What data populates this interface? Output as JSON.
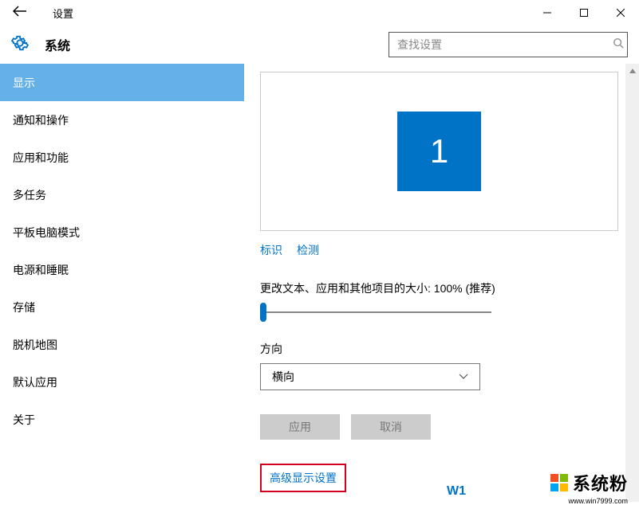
{
  "window": {
    "title": "设置",
    "controls": {
      "min": "—",
      "max": "☐",
      "close": "✕"
    }
  },
  "header": {
    "section": "系统",
    "search_placeholder": "查找设置"
  },
  "sidebar": {
    "items": [
      {
        "label": "显示",
        "selected": true
      },
      {
        "label": "通知和操作",
        "selected": false
      },
      {
        "label": "应用和功能",
        "selected": false
      },
      {
        "label": "多任务",
        "selected": false
      },
      {
        "label": "平板电脑模式",
        "selected": false
      },
      {
        "label": "电源和睡眠",
        "selected": false
      },
      {
        "label": "存储",
        "selected": false
      },
      {
        "label": "脱机地图",
        "selected": false
      },
      {
        "label": "默认应用",
        "selected": false
      },
      {
        "label": "关于",
        "selected": false
      }
    ]
  },
  "content": {
    "monitor_number": "1",
    "identify_label": "标识",
    "detect_label": "检测",
    "scale_label": "更改文本、应用和其他项目的大小: 100% (推荐)",
    "orientation_label": "方向",
    "orientation_value": "横向",
    "apply_label": "应用",
    "cancel_label": "取消",
    "advanced_label": "高级显示设置"
  },
  "watermark": {
    "text": "系统粉",
    "url": "www.win7999.com",
    "extra": "W1"
  }
}
